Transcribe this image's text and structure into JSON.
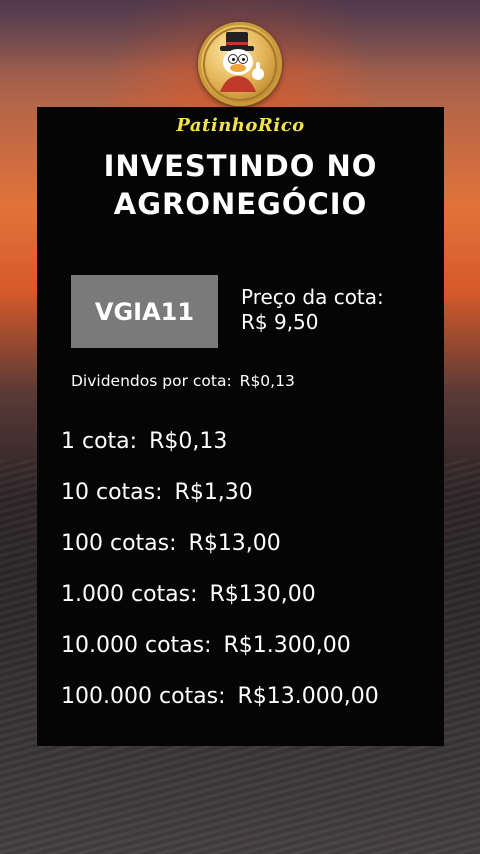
{
  "brand": "PatinhoRico",
  "title_lines": [
    "INVESTINDO NO",
    "AGRONEGÓCIO"
  ],
  "ticker": "VGIA11",
  "price": {
    "label": "Preço da cota:",
    "value": "R$ 9,50"
  },
  "dividend": {
    "label": "Dividendos por cota:",
    "value": "R$0,13"
  },
  "rows": [
    {
      "label": "1 cota:",
      "value": "R$0,13"
    },
    {
      "label": "10 cotas:",
      "value": "R$1,30"
    },
    {
      "label": "100 cotas:",
      "value": "R$13,00"
    },
    {
      "label": "1.000 cotas:",
      "value": "R$130,00"
    },
    {
      "label": "10.000 cotas:",
      "value": "R$1.300,00"
    },
    {
      "label": "100.000 cotas:",
      "value": "R$13.000,00"
    }
  ],
  "colors": {
    "panel": "#050505",
    "brand": "#f2e34a",
    "ticker_box": "#7a7a7a",
    "text": "#ffffff"
  },
  "icons": {
    "logo": "scrooge-coin-icon"
  }
}
